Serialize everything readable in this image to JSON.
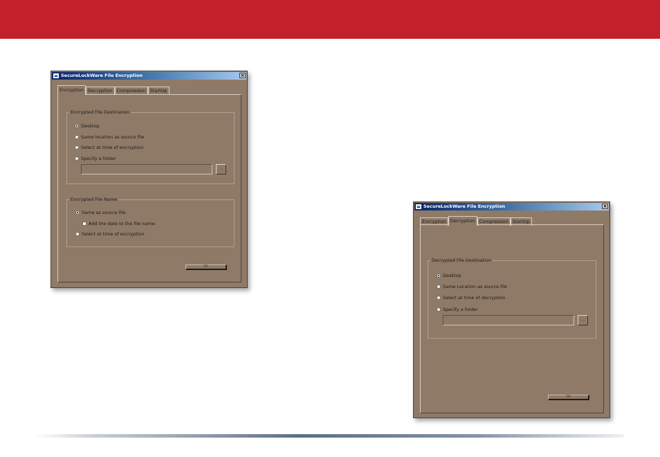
{
  "colors": {
    "banner": "#c3202c",
    "window_bg": "#8f7a68"
  },
  "encryption_window": {
    "title": "SecureLockWare File Encryption",
    "tabs": [
      "Encryption",
      "Decryption",
      "Compression",
      "StartUp"
    ],
    "active_tab": "Encryption",
    "destination_group": {
      "label": "Encrypted File Destination",
      "options": [
        "Desktop",
        "Same location as source file",
        "Select at time of encryption",
        "Specify a folder"
      ],
      "selected": "Desktop",
      "folder_path": "",
      "browse_label": "..."
    },
    "name_group": {
      "label": "Encrypted File Name",
      "option_same": "Same as source file",
      "add_date_label": "Add the date to the file name.",
      "add_date_checked": false,
      "option_select": "Select at time of encryption",
      "selected": "Same as source file"
    },
    "ok_label": "OK"
  },
  "decryption_window": {
    "title": "SecureLockWare File Encryption",
    "tabs": [
      "Encryption",
      "Decryption",
      "Compression",
      "StartUp"
    ],
    "active_tab": "Decryption",
    "destination_group": {
      "label": "Decrypted File Destination",
      "options": [
        "Desktop",
        "Same Location as source file",
        "Select at time of decryption",
        "Specify a folder"
      ],
      "selected": "Desktop",
      "folder_path": "",
      "browse_label": "..."
    },
    "ok_label": "OK"
  }
}
